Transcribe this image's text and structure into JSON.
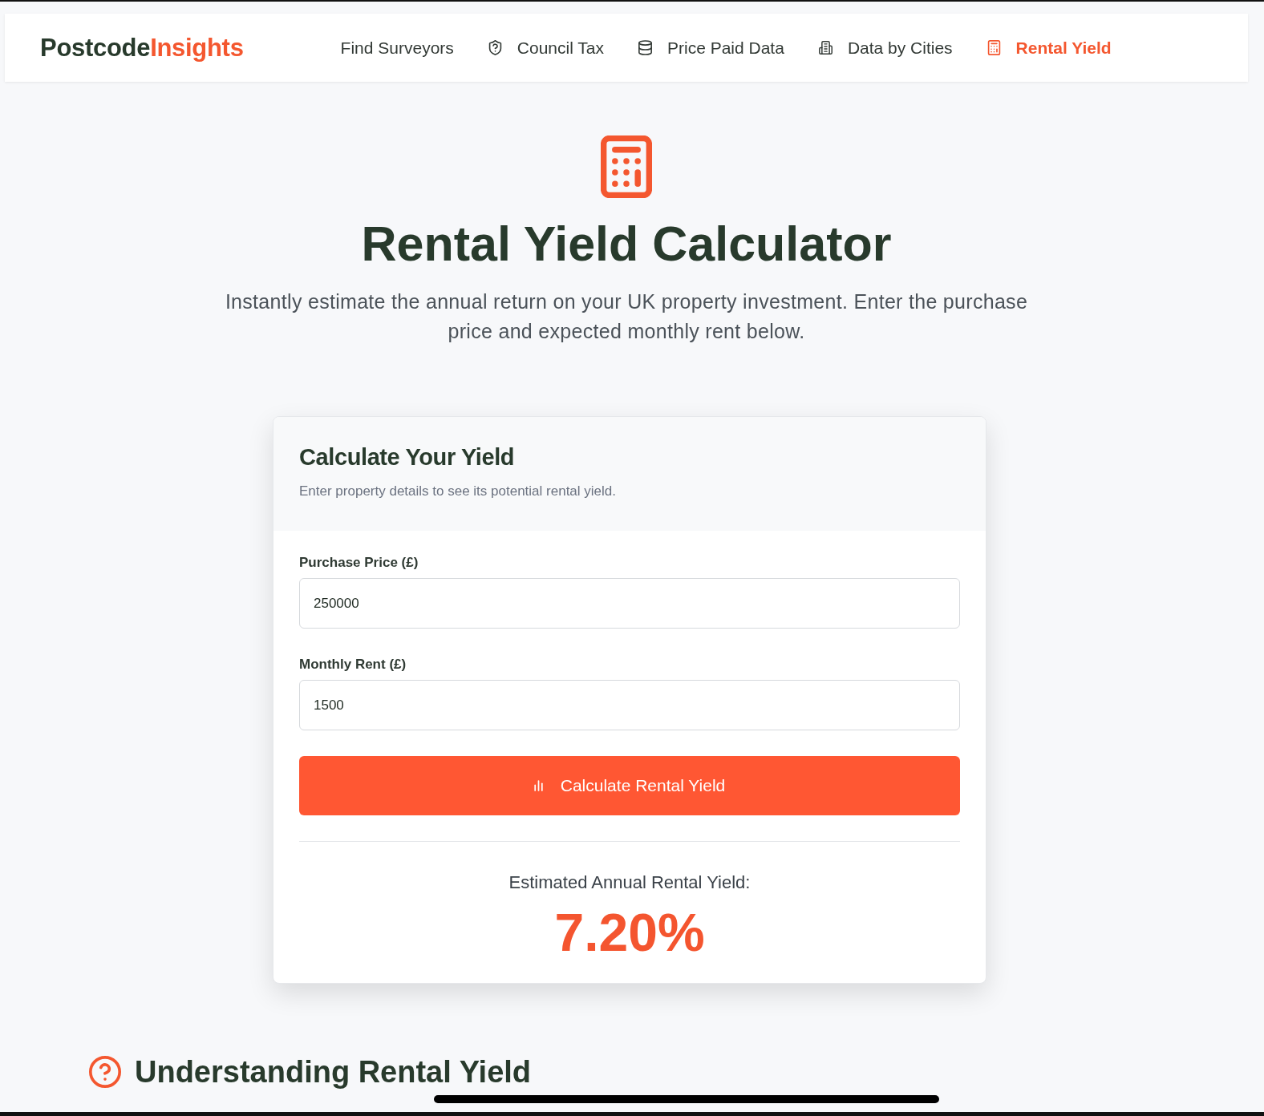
{
  "header": {
    "logo": {
      "primary": "Postcode",
      "accent": "Insights"
    },
    "nav": [
      {
        "label": "Find Surveyors",
        "selected": false
      },
      {
        "label": "Council Tax",
        "selected": false
      },
      {
        "label": "Price Paid Data",
        "selected": false
      },
      {
        "label": "Data by Cities",
        "selected": false
      },
      {
        "label": "Rental Yield",
        "selected": true
      }
    ]
  },
  "hero": {
    "title": "Rental Yield Calculator",
    "subtitle": "Instantly estimate the annual return on your UK property investment. Enter the purchase price and expected monthly rent below."
  },
  "calculator": {
    "title": "Calculate Your Yield",
    "subtitle": "Enter property details to see its potential rental yield.",
    "fields": [
      {
        "label": "Purchase Price (£)",
        "value": "250000"
      },
      {
        "label": "Monthly Rent (£)",
        "value": "1500"
      }
    ],
    "button": "Calculate Rental Yield",
    "result": {
      "label": "Estimated Annual Rental Yield:",
      "value": "7.20%"
    }
  },
  "section": {
    "title": "Understanding Rental Yield"
  }
}
